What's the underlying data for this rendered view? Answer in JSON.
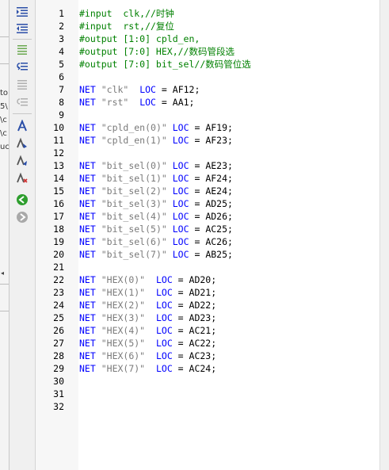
{
  "left_pane": {
    "fragments": [
      "to",
      "5\\",
      "\\c",
      "\\c",
      "uc"
    ]
  },
  "toolbar": {
    "buttons": [
      {
        "name": "toggle-bookmark",
        "icon": "indent-icon"
      },
      {
        "name": "next-bookmark",
        "icon": "outdent-icon"
      },
      {
        "name": "comment",
        "icon": "comment-lines-icon"
      },
      {
        "name": "undo",
        "icon": "undo-icon"
      },
      {
        "name": "uncomment",
        "icon": "uncomment-lines-icon"
      },
      {
        "name": "redo",
        "icon": "redo-icon"
      },
      {
        "name": "bookmark",
        "icon": "bookmark-icon"
      },
      {
        "name": "next-bm",
        "icon": "next-bookmark-icon"
      },
      {
        "name": "prev-bm",
        "icon": "prev-bookmark-icon"
      },
      {
        "name": "clear-bm",
        "icon": "clear-bookmarks-icon"
      },
      {
        "name": "back",
        "icon": "back-arrow-icon"
      },
      {
        "name": "forward",
        "icon": "forward-arrow-icon"
      }
    ],
    "colors": {
      "back": "#2e9e2e",
      "forward": "#a8a8a8"
    }
  },
  "editor": {
    "lines": [
      {
        "n": "1",
        "t": "comment",
        "text": "#input  clk,//时钟"
      },
      {
        "n": "2",
        "t": "comment",
        "text": "#input  rst,//复位"
      },
      {
        "n": "3",
        "t": "comment",
        "text": "#output [1:0] cpld_en,"
      },
      {
        "n": "4",
        "t": "comment",
        "text": "#output [7:0] HEX,//数码管段选"
      },
      {
        "n": "5",
        "t": "comment",
        "text": "#output [7:0] bit_sel//数码管位选"
      },
      {
        "n": "6",
        "t": "empty"
      },
      {
        "n": "7",
        "t": "net",
        "sig": "\"clk\"",
        "pad": "  ",
        "pin": "AF12"
      },
      {
        "n": "8",
        "t": "net",
        "sig": "\"rst\"",
        "pad": "  ",
        "pin": "AA1"
      },
      {
        "n": "9",
        "t": "empty"
      },
      {
        "n": "10",
        "t": "net",
        "sig": "\"cpld_en(0)\"",
        "pad": " ",
        "pin": "AF19"
      },
      {
        "n": "11",
        "t": "net",
        "sig": "\"cpld_en(1)\"",
        "pad": " ",
        "pin": "AF23"
      },
      {
        "n": "12",
        "t": "empty"
      },
      {
        "n": "13",
        "t": "net",
        "sig": "\"bit_sel(0)\"",
        "pad": " ",
        "pin": "AE23"
      },
      {
        "n": "14",
        "t": "net",
        "sig": "\"bit_sel(1)\"",
        "pad": " ",
        "pin": "AF24"
      },
      {
        "n": "15",
        "t": "net",
        "sig": "\"bit_sel(2)\"",
        "pad": " ",
        "pin": "AE24"
      },
      {
        "n": "16",
        "t": "net",
        "sig": "\"bit_sel(3)\"",
        "pad": " ",
        "pin": "AD25"
      },
      {
        "n": "17",
        "t": "net",
        "sig": "\"bit_sel(4)\"",
        "pad": " ",
        "pin": "AD26"
      },
      {
        "n": "18",
        "t": "net",
        "sig": "\"bit_sel(5)\"",
        "pad": " ",
        "pin": "AC25"
      },
      {
        "n": "19",
        "t": "net",
        "sig": "\"bit_sel(6)\"",
        "pad": " ",
        "pin": "AC26"
      },
      {
        "n": "20",
        "t": "net",
        "sig": "\"bit_sel(7)\"",
        "pad": " ",
        "pin": "AB25"
      },
      {
        "n": "21",
        "t": "empty"
      },
      {
        "n": "22",
        "t": "net",
        "sig": "\"HEX(0)\"",
        "pad": "  ",
        "pin": "AD20"
      },
      {
        "n": "23",
        "t": "net",
        "sig": "\"HEX(1)\"",
        "pad": "  ",
        "pin": "AD21"
      },
      {
        "n": "24",
        "t": "net",
        "sig": "\"HEX(2)\"",
        "pad": "  ",
        "pin": "AD22"
      },
      {
        "n": "25",
        "t": "net",
        "sig": "\"HEX(3)\"",
        "pad": "  ",
        "pin": "AD23"
      },
      {
        "n": "26",
        "t": "net",
        "sig": "\"HEX(4)\"",
        "pad": "  ",
        "pin": "AC21"
      },
      {
        "n": "27",
        "t": "net",
        "sig": "\"HEX(5)\"",
        "pad": "  ",
        "pin": "AC22"
      },
      {
        "n": "28",
        "t": "net",
        "sig": "\"HEX(6)\"",
        "pad": "  ",
        "pin": "AC23"
      },
      {
        "n": "29",
        "t": "net",
        "sig": "\"HEX(7)\"",
        "pad": "  ",
        "pin": "AC24"
      },
      {
        "n": "30",
        "t": "empty"
      },
      {
        "n": "31",
        "t": "empty"
      },
      {
        "n": "32",
        "t": "empty"
      }
    ],
    "keywords": {
      "net": "NET",
      "loc": "LOC",
      "eq": "=",
      "semi": ";"
    },
    "colors": {
      "comment": "#008000",
      "keyword": "#0000ff",
      "string": "#7a7a7a"
    }
  }
}
